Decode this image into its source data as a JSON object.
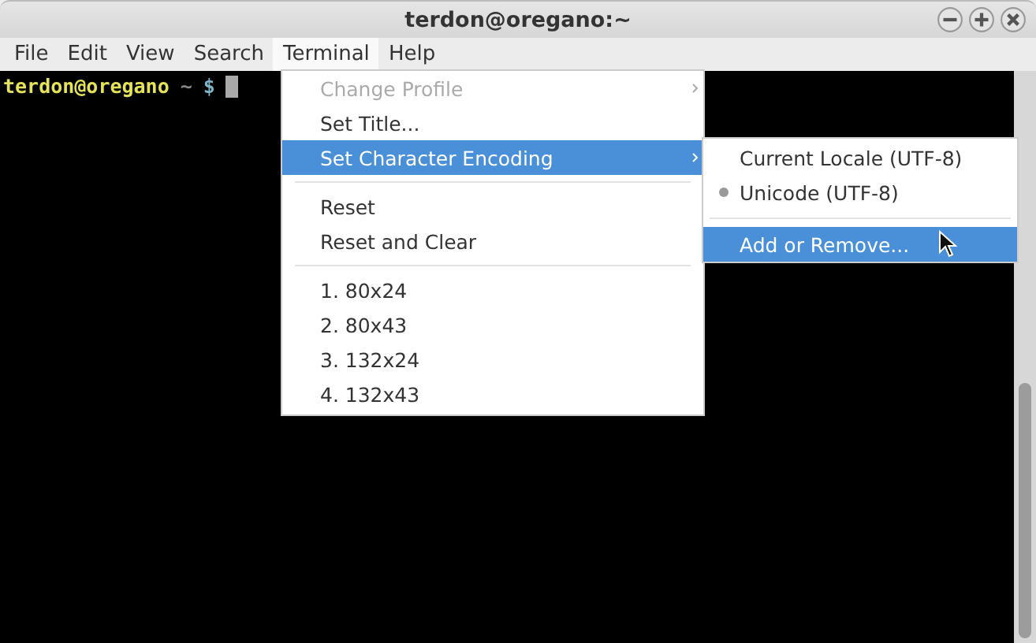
{
  "window": {
    "title": "terdon@oregano:~"
  },
  "menubar": [
    {
      "label": "File",
      "selected": false
    },
    {
      "label": "Edit",
      "selected": false
    },
    {
      "label": "View",
      "selected": false
    },
    {
      "label": "Search",
      "selected": false
    },
    {
      "label": "Terminal",
      "selected": true
    },
    {
      "label": "Help",
      "selected": false
    }
  ],
  "terminal": {
    "prompt_user": "terdon@oregano",
    "prompt_path": "~",
    "prompt_symbol": "$"
  },
  "terminal_menu": [
    {
      "kind": "item",
      "label": "Change Profile",
      "disabled": true,
      "selected": false,
      "submenu": true
    },
    {
      "kind": "item",
      "label": "Set Title...",
      "disabled": false,
      "selected": false,
      "submenu": false
    },
    {
      "kind": "item",
      "label": "Set Character Encoding",
      "disabled": false,
      "selected": true,
      "submenu": true
    },
    {
      "kind": "separator"
    },
    {
      "kind": "item",
      "label": "Reset",
      "disabled": false,
      "selected": false,
      "submenu": false
    },
    {
      "kind": "item",
      "label": "Reset and Clear",
      "disabled": false,
      "selected": false,
      "submenu": false
    },
    {
      "kind": "separator"
    },
    {
      "kind": "item",
      "label": "1. 80x24",
      "disabled": false,
      "selected": false,
      "submenu": false
    },
    {
      "kind": "item",
      "label": "2. 80x43",
      "disabled": false,
      "selected": false,
      "submenu": false
    },
    {
      "kind": "item",
      "label": "3. 132x24",
      "disabled": false,
      "selected": false,
      "submenu": false
    },
    {
      "kind": "item",
      "label": "4. 132x43",
      "disabled": false,
      "selected": false,
      "submenu": false
    }
  ],
  "encoding_submenu": [
    {
      "kind": "radio",
      "label": "Current Locale (UTF-8)",
      "checked": false,
      "selected": false
    },
    {
      "kind": "radio",
      "label": "Unicode (UTF-8)",
      "checked": true,
      "selected": false
    },
    {
      "kind": "separator"
    },
    {
      "kind": "item",
      "label": "Add or Remove...",
      "selected": true
    }
  ]
}
